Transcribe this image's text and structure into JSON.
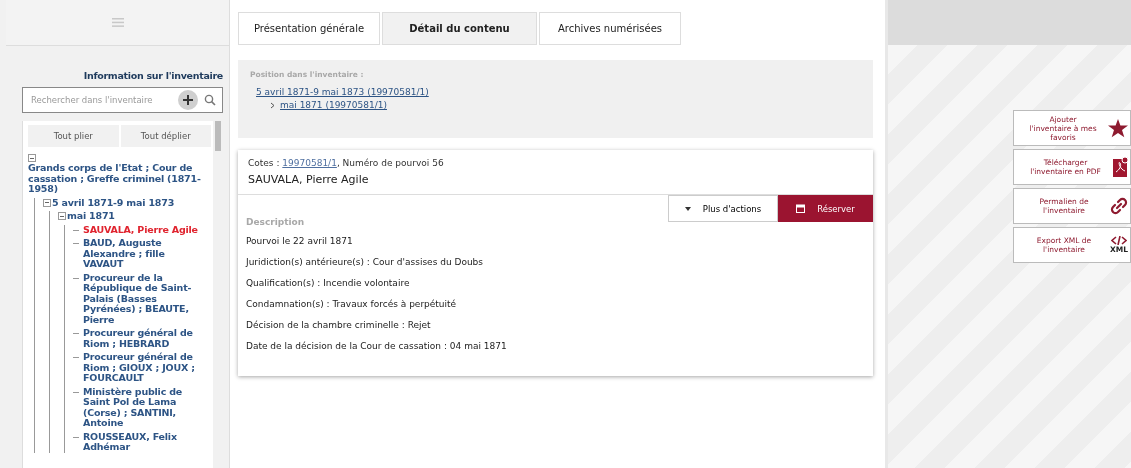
{
  "sidebar": {
    "heading": "Information sur l'inventaire",
    "search": {
      "placeholder": "Rechercher dans l'inventaire"
    },
    "buttons": [
      "Tout plier",
      "Tout déplier"
    ],
    "tree": [
      {
        "label": "Grands corps de l'Etat ; Cour de cassation ; Greffe criminel (1871-1958)",
        "expanded": true,
        "selected": false,
        "children": [
          {
            "label": "5 avril 1871-9 mai 1873",
            "expanded": true,
            "selected": false,
            "children": [
              {
                "label": "mai 1871",
                "expanded": true,
                "selected": false,
                "children": [
                  {
                    "label": "SAUVALA, Pierre Agile",
                    "selected": true
                  },
                  {
                    "label": "BAUD, Auguste Alexandre ; fille VAVAUT",
                    "selected": false
                  },
                  {
                    "label": "Procureur de la République de Saint-Palais (Basses Pyrénées) ; BEAUTE, Pierre",
                    "selected": false
                  },
                  {
                    "label": "Procureur général de Riom ; HEBRARD",
                    "selected": false
                  },
                  {
                    "label": "Procureur général de Riom ; GIOUX ; JOUX ; FOURCAULT",
                    "selected": false
                  },
                  {
                    "label": "Ministère public de Saint Pol de Lama (Corse) ; SANTINI, Antoine",
                    "selected": false
                  },
                  {
                    "label": "ROUSSEAUX, Felix Adhémar",
                    "selected": false
                  }
                ]
              }
            ]
          }
        ]
      }
    ]
  },
  "tabs": [
    {
      "label": "Présentation générale",
      "selected": false
    },
    {
      "label": "Détail du contenu",
      "selected": true
    },
    {
      "label": "Archives numérisées",
      "selected": false
    }
  ],
  "position": {
    "label": "Position dans l'inventaire :",
    "links": [
      "5 avril 1871-9 mai 1873 (19970581/1)",
      "mai 1871 (19970581/1)"
    ]
  },
  "record": {
    "cotes_label": "Cotes : ",
    "cote": "19970581/1",
    "cotes_rest": ", Numéro de pourvoi 56",
    "title": "SAUVALA, Pierre Agile",
    "actions": [
      {
        "kind": "menu",
        "label": "Plus d'actions"
      },
      {
        "kind": "primary",
        "label": "Réserver"
      }
    ],
    "description_label": "Description",
    "lines": [
      "Pourvoi le 22 avril 1871",
      "Juridiction(s) antérieure(s) : Cour d'assises du Doubs",
      "Qualification(s) : Incendie volontaire",
      "Condamnation(s) : Travaux forcés à perpétuité",
      "Décision de la chambre criminelle : Rejet",
      "Date de la décision de la Cour de cassation : 04 mai 1871"
    ]
  },
  "tools": [
    {
      "kind": "star",
      "label": "Ajouter l'inventaire à mes favoris"
    },
    {
      "kind": "pdf",
      "label": "Télécharger l'inventaire en PDF"
    },
    {
      "kind": "link",
      "label": "Permalien de l'inventaire"
    },
    {
      "kind": "xml",
      "label": "Export XML de l'inventaire",
      "icon_label": "XML"
    }
  ]
}
